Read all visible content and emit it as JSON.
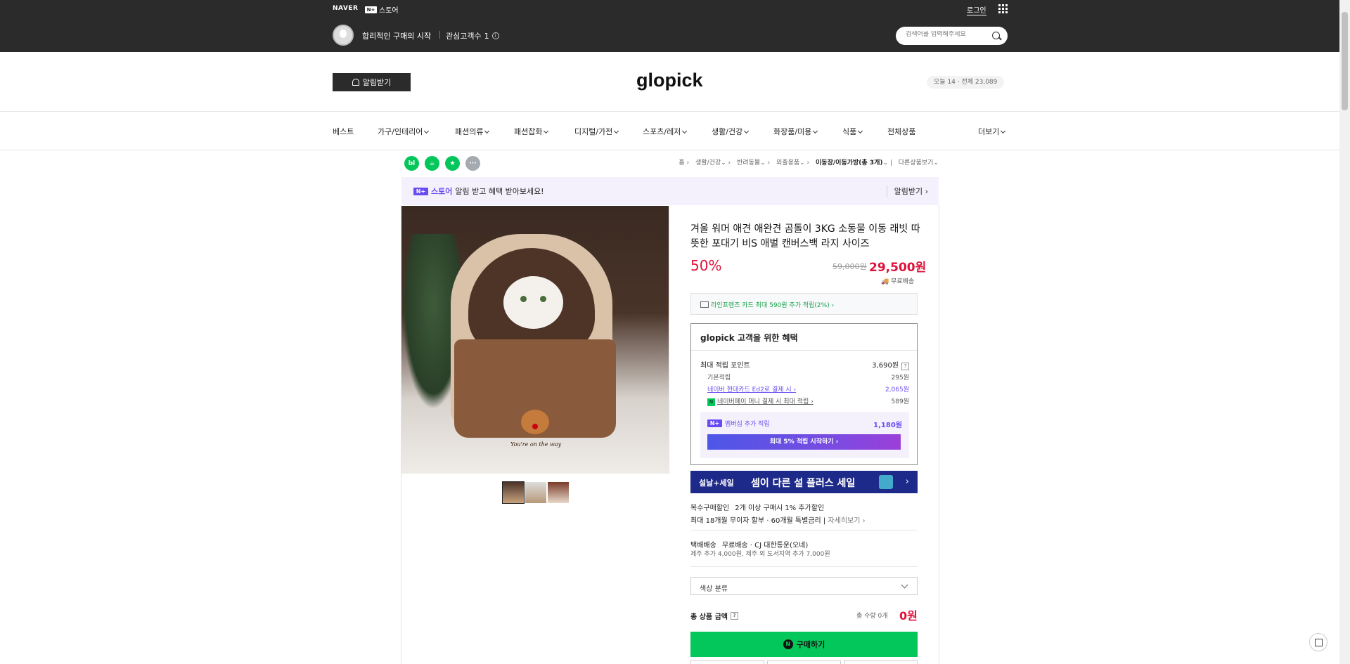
{
  "topbar": {
    "naver": "NAVER",
    "nstore_badge": "N+",
    "nstore": "스토어",
    "login": "로그인",
    "slogan": "합리적인 구매의 시작",
    "fav_label": "관심고객수",
    "fav_count": "1",
    "search_placeholder": "검색어를 입력해주세요"
  },
  "header": {
    "alarm_button": "알림받기",
    "logo": "glopick",
    "visitors": "오늘 14 · 전체 23,089"
  },
  "nav": {
    "items": [
      "베스트",
      "가구/인테리어",
      "패션의류",
      "패션잡화",
      "디지털/가전",
      "스포츠/레저",
      "생활/건강",
      "화장품/미용",
      "식품",
      "전체상품"
    ],
    "more": "더보기"
  },
  "share_buttons": [
    "bl",
    "☕",
    "★",
    "···"
  ],
  "breadcrumb": [
    "홈",
    "생활/건강",
    "반려동물",
    "외출용품",
    "이동장/이동가방(총 3개)",
    "다른상품보기"
  ],
  "banner": {
    "badge": "N+",
    "store": "스토어",
    "text": "알림 받고 혜택 받아보세요!",
    "right": "알림받기 ›"
  },
  "product": {
    "title": "겨울 워머 애견 애완견 곰돌이 3KG 소동물 이동 래빗 따뜻한 포대기 비S 애벌 캔버스백 라지 사이즈",
    "discount": "50%",
    "original_price": "59,000원",
    "price": "29,500원",
    "shipping": "무료배송",
    "image_tagline": "You're on the way",
    "card_offer": "라인프렌즈 카드 최대 590원 추가 적립(2%) ›"
  },
  "benefit": {
    "title": "glopick 고객을 위한 혜택",
    "max_label": "최대 적립 포인트",
    "max_value": "3,690원",
    "rows": [
      {
        "label": "기본적립",
        "value": "295원"
      },
      {
        "label": "네이버 현대카드 Ed2로 결제 시 ›",
        "value": "2,065원"
      },
      {
        "label": "네이버페이 머니 결제 시 최대 적립 ›",
        "value": "589원"
      }
    ],
    "member_badge": "N+",
    "member_label": "멤버십 추가 적립",
    "member_value": "1,180원",
    "member_button": "최대 5% 적립 시작하기 ›"
  },
  "promo": {
    "tag": "설날+세일",
    "text": "셈이 다른 설 플러스 세일",
    "arrow": "›"
  },
  "info": {
    "multi_label": "복수구매할인",
    "multi_value": "2개 이상 구매시 1% 추가할인",
    "installment": "최대 18개월 무이자 할부 · 60개월 특별금리",
    "detail": "자세히보기 ›",
    "ship_label": "택배배송",
    "ship_value": "무료배송 · CJ 대한통운(오네)",
    "ship_extra": "제주 추가 4,000원, 제주 외 도서지역 추가 7,000원"
  },
  "option": {
    "placeholder": "색상 분류"
  },
  "total": {
    "label": "총 상품 금액",
    "count": "총 수량 0개",
    "value": "0원"
  },
  "buy_button": "구매하기",
  "colors": {
    "topbar": "#2b2b2b",
    "accent_red": "#e0123a",
    "naver_green": "#03c75a",
    "purple": "#6a4bf2",
    "promo_blue": "#1e2a8a"
  }
}
